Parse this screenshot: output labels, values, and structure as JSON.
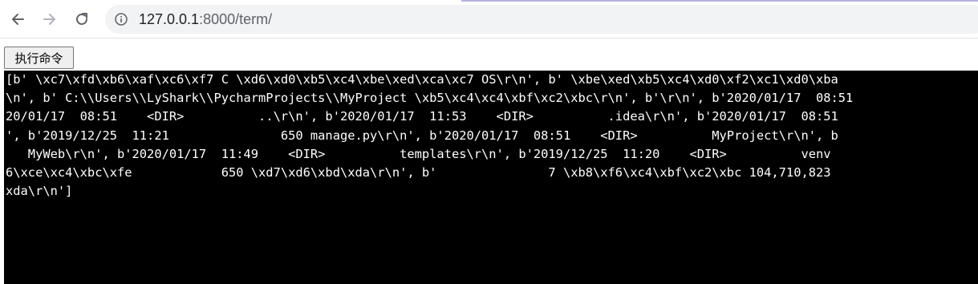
{
  "browser": {
    "url_host": "127.0.0.1",
    "url_rest": ":8000/term/",
    "icons": [
      "back-arrow-icon",
      "forward-arrow-icon",
      "reload-icon",
      "info-icon"
    ],
    "accent_color": "#b6b1df"
  },
  "page": {
    "run_button_label": "执行命令",
    "terminal": {
      "background": "#000000",
      "foreground": "#ffffff",
      "lines": [
        "[b' \\xc7\\xfd\\xb6\\xaf\\xc6\\xf7 C \\xd6\\xd0\\xb5\\xc4\\xbe\\xed\\xca\\xc7 OS\\r\\n', b' \\xbe\\xed\\xb5\\xc4\\xd0\\xf2\\xc1\\xd0\\xba",
        "\\n', b' C:\\\\Users\\\\LyShark\\\\PycharmProjects\\\\MyProject \\xb5\\xc4\\xc4\\xbf\\xc2\\xbc\\r\\n', b'\\r\\n', b'2020/01/17  08:51",
        "20/01/17  08:51    <DIR>          ..\\r\\n', b'2020/01/17  11:53    <DIR>          .idea\\r\\n', b'2020/01/17  08:51",
        "', b'2019/12/25  11:21               650 manage.py\\r\\n', b'2020/01/17  08:51    <DIR>          MyProject\\r\\n', b",
        "   MyWeb\\r\\n', b'2020/01/17  11:49    <DIR>          templates\\r\\n', b'2019/12/25  11:20    <DIR>          venv",
        "6\\xce\\xc4\\xbc\\xfe            650 \\xd7\\xd6\\xbd\\xda\\r\\n', b'               7 \\xb8\\xf6\\xc4\\xbf\\xc2\\xbc 104,710,823",
        "xda\\r\\n']"
      ]
    }
  }
}
